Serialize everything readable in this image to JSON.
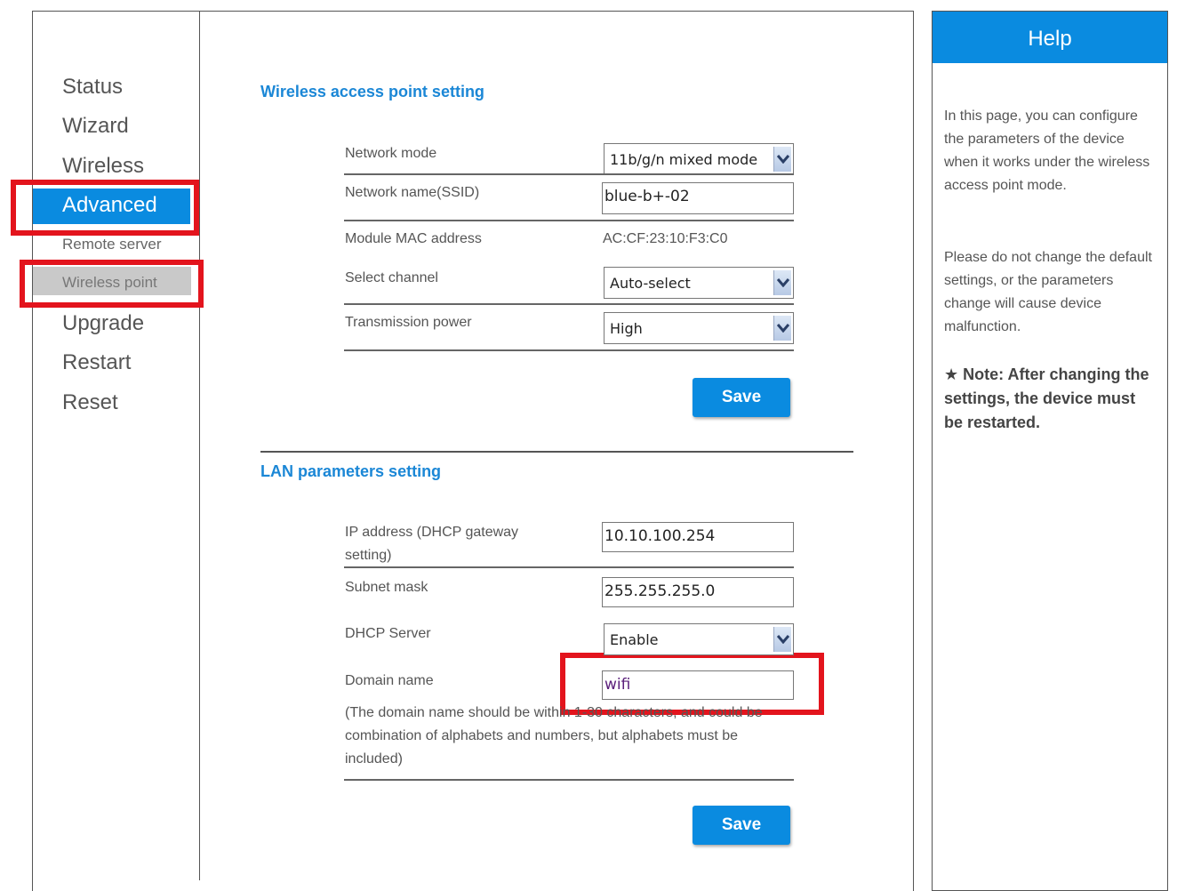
{
  "nav": {
    "items": [
      {
        "label": "Status"
      },
      {
        "label": "Wizard"
      },
      {
        "label": "Wireless"
      },
      {
        "label": "Advanced"
      },
      {
        "label": "Remote server"
      },
      {
        "label": "Wireless point"
      },
      {
        "label": "Upgrade"
      },
      {
        "label": "Restart"
      },
      {
        "label": "Reset"
      }
    ],
    "active_item": "Advanced",
    "active_subitem": "Wireless point"
  },
  "wireless_section": {
    "title": "Wireless access point setting",
    "network_mode": {
      "label": "Network mode",
      "value": "11b/g/n mixed mode"
    },
    "ssid": {
      "label": "Network name(SSID)",
      "value": "blue-b+-02"
    },
    "mac": {
      "label": "Module MAC address",
      "value": "AC:CF:23:10:F3:C0"
    },
    "channel": {
      "label": "Select channel",
      "value": "Auto-select"
    },
    "power": {
      "label": "Transmission power",
      "value": "High"
    },
    "save_label": "Save"
  },
  "lan_section": {
    "title": "LAN parameters setting",
    "ip": {
      "label": "IP address (DHCP gateway setting)",
      "value": "10.10.100.254"
    },
    "subnet": {
      "label": "Subnet mask",
      "value": "255.255.255.0"
    },
    "dhcp": {
      "label": "DHCP Server",
      "value": "Enable"
    },
    "domain": {
      "label": "Domain name",
      "value": "wifi"
    },
    "domain_note": "(The domain name should be within 1-30 characters, and could be combination of alphabets and numbers, but alphabets must be included)",
    "save_label": "Save"
  },
  "help": {
    "title": "Help",
    "paragraph1": "In this page, you can configure the parameters of the device when it works under the wireless access point mode.",
    "paragraph2": "Please do not change the default settings, or the parameters change will cause device malfunction.",
    "note_star": "★",
    "note": "Note: After changing the settings, the device must be restarted."
  },
  "colors": {
    "accent": "#0A8BE0",
    "highlight": "#E3141D",
    "section_title": "#1B87D6"
  }
}
